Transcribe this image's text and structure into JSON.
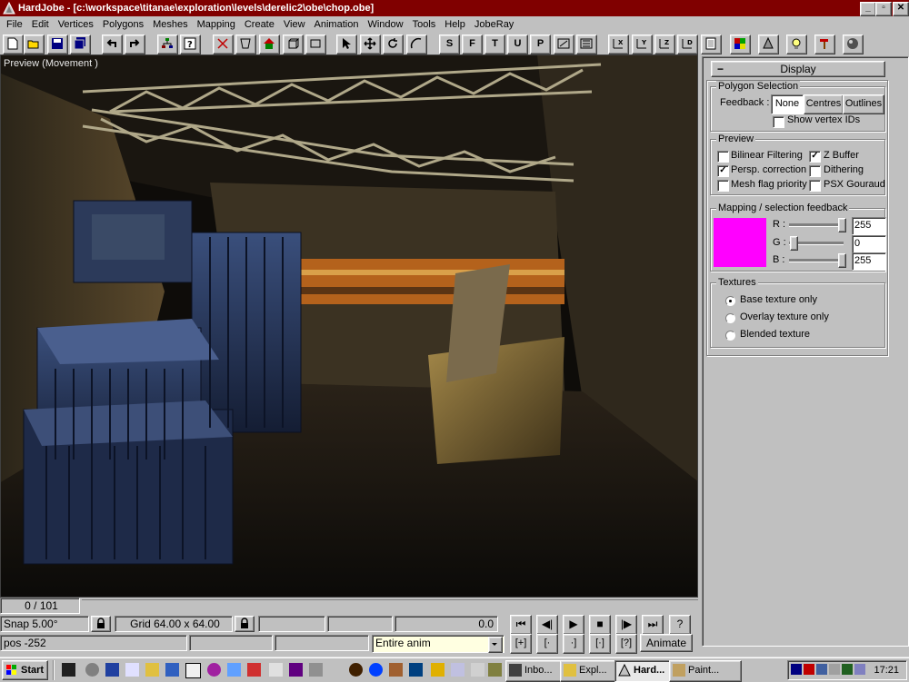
{
  "window": {
    "app_name": "HardJobe",
    "title": "HardJobe - [c:\\workspace\\titanae\\exploration\\levels\\derelic2\\obe\\chop.obe]"
  },
  "caption_buttons": {
    "minimize": "_",
    "restore": "▫",
    "close": "✕"
  },
  "menu": [
    "File",
    "Edit",
    "Vertices",
    "Polygons",
    "Meshes",
    "Mapping",
    "Create",
    "View",
    "Animation",
    "Window",
    "Tools",
    "Help",
    "JobeRay"
  ],
  "toolbar_text_buttons": [
    "S",
    "F",
    "T",
    "U",
    "P"
  ],
  "viewport": {
    "label": "Preview (Movement )"
  },
  "display_panel": {
    "collapse_label": "−",
    "header": "Display",
    "polygon_selection": {
      "title": "Polygon Selection",
      "feedback_label": "Feedback :",
      "feedback_options": [
        "None",
        "Centres",
        "Outlines"
      ],
      "selected": "None",
      "show_vertex_ids": {
        "label": "Show vertex IDs",
        "checked": false
      }
    },
    "preview": {
      "title": "Preview",
      "options": [
        {
          "label": "Bilinear Filtering",
          "checked": false
        },
        {
          "label": "Z Buffer",
          "checked": true
        },
        {
          "label": "Persp. correction",
          "checked": true
        },
        {
          "label": "Dithering",
          "checked": false
        },
        {
          "label": "Mesh flag priority",
          "checked": false
        },
        {
          "label": "PSX Gouraud",
          "checked": false
        }
      ]
    },
    "mapping": {
      "title": "Mapping / selection feedback",
      "swatch_color": "#ff00ff",
      "channels": [
        {
          "label": "R :",
          "value": "255"
        },
        {
          "label": "G :",
          "value": "0"
        },
        {
          "label": "B :",
          "value": "255"
        }
      ]
    },
    "textures": {
      "title": "Textures",
      "options": [
        {
          "label": "Base texture only",
          "selected": true
        },
        {
          "label": "Overlay texture only",
          "selected": false
        },
        {
          "label": "Blended texture",
          "selected": false
        }
      ]
    }
  },
  "status": {
    "frame": "0 / 101",
    "snap": "Snap 5.00°",
    "grid": "Grid 64.00 x 64.00",
    "time_value": "0.0",
    "pos": "pos -252",
    "anim_select": "Entire anim"
  },
  "playback": {
    "row1": [
      "⏮",
      "◀|",
      "▶",
      "■",
      "|▶",
      "⏭",
      "?"
    ],
    "row2": [
      "[+]",
      "[·",
      "·]",
      "[·]",
      "[?]"
    ],
    "animate_label": "Animate"
  },
  "taskbar": {
    "start_label": "Start",
    "tasks": [
      {
        "label": "Inbo...",
        "active": false
      },
      {
        "label": "Expl...",
        "active": false
      },
      {
        "label": "Hard...",
        "active": true
      },
      {
        "label": "Paint...",
        "active": false
      }
    ],
    "clock": "17:21"
  },
  "colors": {
    "title_bar": "#800000",
    "face": "#c0c0c0",
    "selection_swatch": "#ff00ff",
    "anim_select_bg": "#ffffe1"
  }
}
